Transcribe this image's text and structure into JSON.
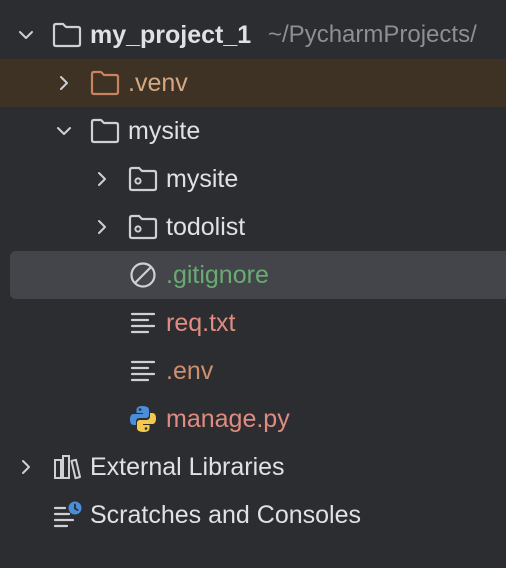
{
  "project_tree": {
    "root": {
      "name": "my_project_1",
      "path_hint": "~/PycharmProjects/"
    },
    "items": [
      {
        "label": ".venv",
        "color": "#d5a883"
      },
      {
        "label": "mysite",
        "color": "#dfe1e5"
      },
      {
        "label": "mysite",
        "color": "#dfe1e5"
      },
      {
        "label": "todolist",
        "color": "#dfe1e5"
      },
      {
        "label": ".gitignore",
        "color": "#6aab73"
      },
      {
        "label": "req.txt",
        "color": "#e08c80"
      },
      {
        "label": ".env",
        "color": "#cf8e6d"
      },
      {
        "label": "manage.py",
        "color": "#e08c80"
      }
    ],
    "external_libraries": {
      "label": "External Libraries"
    },
    "scratches": {
      "label": "Scratches and Consoles"
    }
  },
  "colors": {
    "background": "#2b2d30",
    "selection": "#43454a",
    "excluded_row": "#3d3223",
    "text": "#dfe1e5",
    "hint_text": "#8c8f94",
    "ignored_text": "#6aab73",
    "modified_text": "#e08c80",
    "excluded_folder_icon": "#c9845f"
  },
  "icons": {
    "expand": "chevron-down-icon",
    "collapse": "chevron-right-icon",
    "folder": "folder-icon",
    "package": "package-folder-icon",
    "ignored_file": "gitignore-icon",
    "text_file": "text-file-icon",
    "python_file": "python-file-icon",
    "libraries": "libraries-icon",
    "scratches": "scratches-icon"
  }
}
